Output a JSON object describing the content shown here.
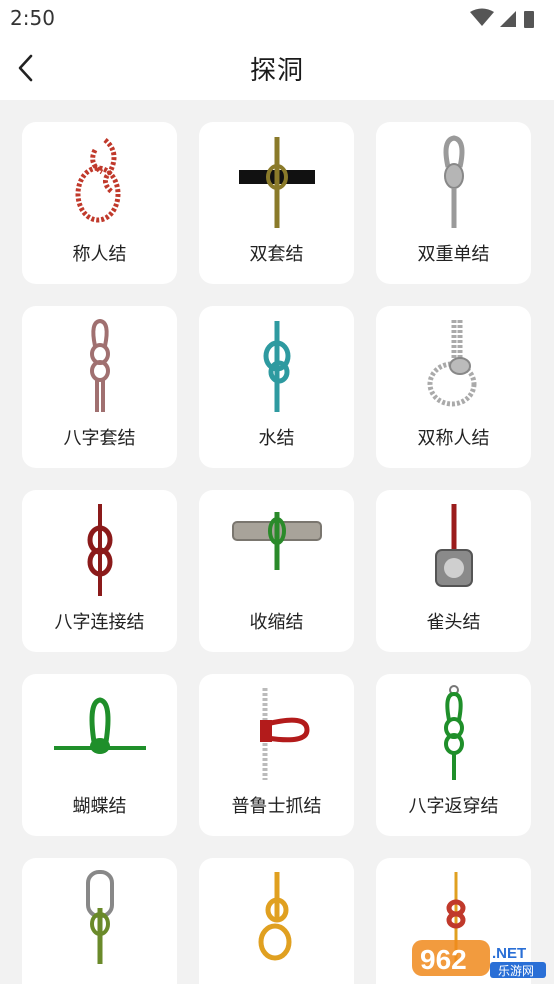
{
  "status_bar": {
    "time": "2:50"
  },
  "header": {
    "title": "探洞"
  },
  "knots": [
    {
      "label": "称人结",
      "color": "#c0392b"
    },
    {
      "label": "双套结",
      "color": "#8a7a2a"
    },
    {
      "label": "双重单结",
      "color": "#9a9a9a"
    },
    {
      "label": "八字套结",
      "color": "#a07070"
    },
    {
      "label": "水结",
      "color": "#2e9aa0"
    },
    {
      "label": "双称人结",
      "color": "#aaaaaa"
    },
    {
      "label": "八字连接结",
      "color": "#8b1a1a"
    },
    {
      "label": "收缩结",
      "color": "#2a8a2a"
    },
    {
      "label": "雀头结",
      "color": "#9b1c1c"
    },
    {
      "label": "蝴蝶结",
      "color": "#1f8f2a"
    },
    {
      "label": "普鲁士抓结",
      "color": "#b31b1b"
    },
    {
      "label": "八字返穿结",
      "color": "#1f8f2a"
    },
    {
      "label": "",
      "color": "#6a8a2a"
    },
    {
      "label": "",
      "color": "#e0a020"
    },
    {
      "label": "",
      "color": "#c0392b"
    }
  ],
  "watermark": {
    "text_big": "962",
    "text_suffix": ".NET",
    "text_small": "乐游网"
  }
}
